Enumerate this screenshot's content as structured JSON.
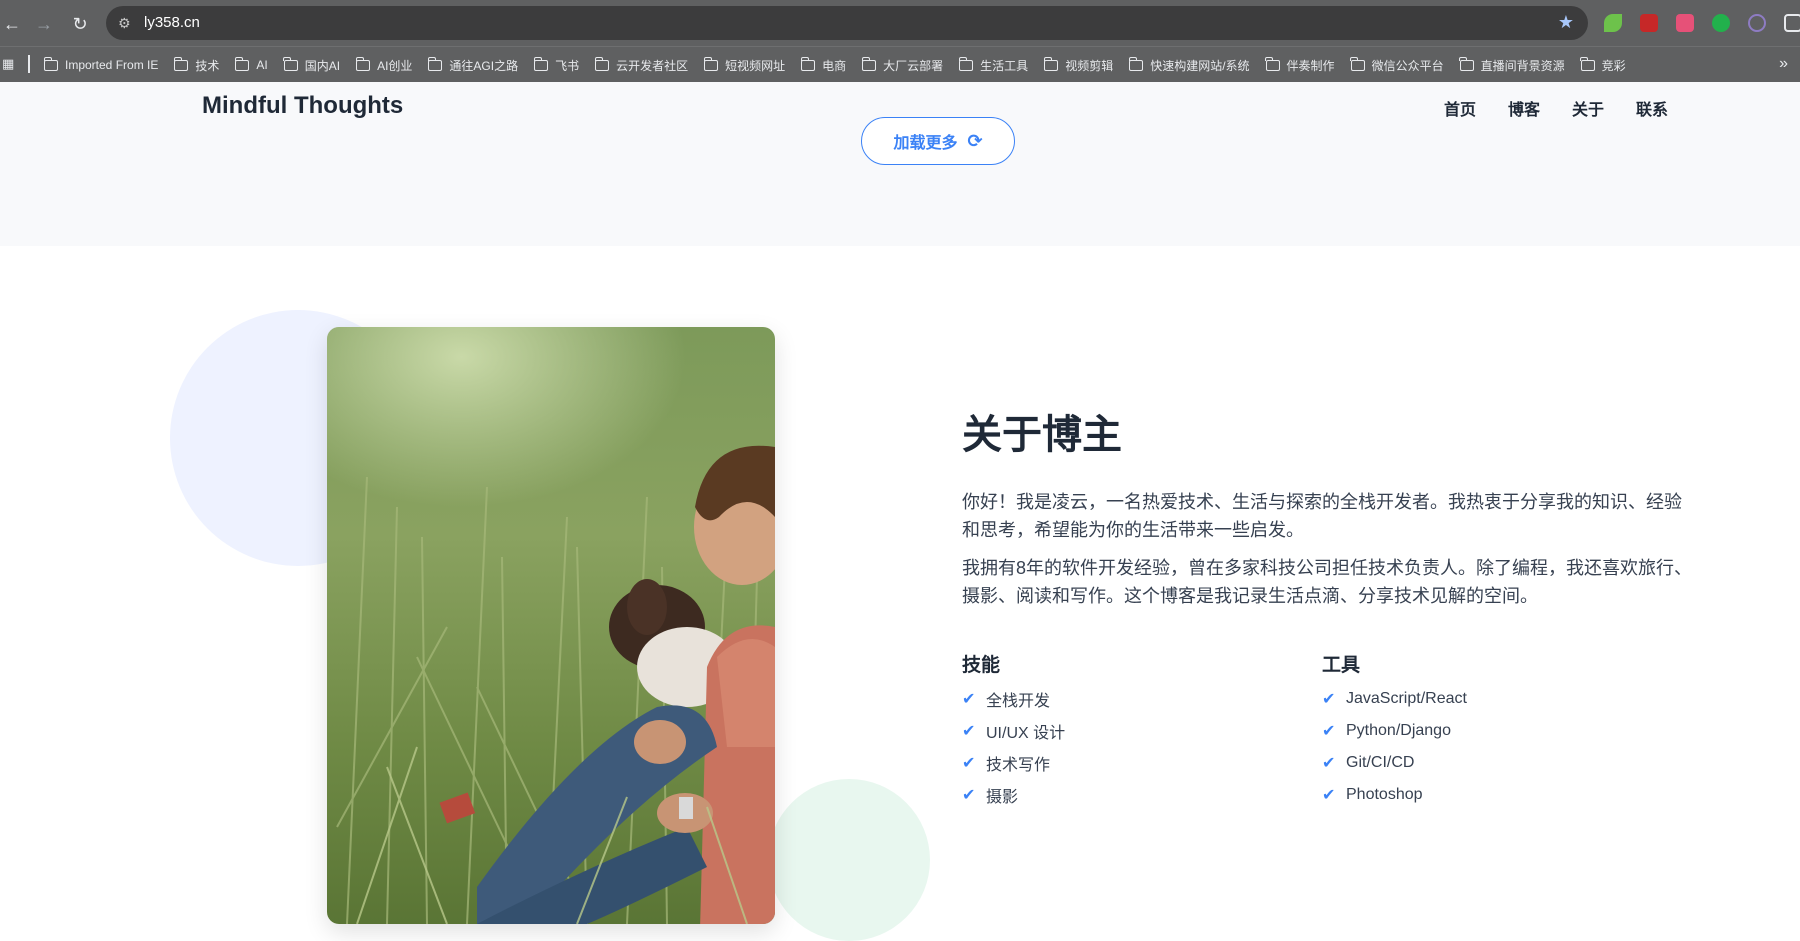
{
  "browser": {
    "url": "ly358.cn",
    "bookmarks": [
      "Imported From IE",
      "技术",
      "AI",
      "国内AI",
      "AI创业",
      "通往AGI之路",
      "飞书",
      "云开发者社区",
      "短视频网址",
      "电商",
      "大厂云部署",
      "生活工具",
      "视频剪辑",
      "快速构建网站/系统",
      "伴奏制作",
      "微信公众平台",
      "直播间背景资源",
      "竞彩"
    ]
  },
  "header": {
    "brand": "Mindful Thoughts",
    "nav": [
      "首页",
      "博客",
      "关于",
      "联系"
    ]
  },
  "load_more": {
    "label": "加载更多",
    "icon": "refresh-icon",
    "color": "#3b82f6"
  },
  "about": {
    "title": "关于博主",
    "paragraphs": [
      "你好！我是凌云，一名热爱技术、生活与探索的全栈开发者。我热衷于分享我的知识、经验和思考，希望能为你的生活带来一些启发。",
      "我拥有8年的软件开发经验，曾在多家科技公司担任技术负责人。除了编程，我还喜欢旅行、摄影、阅读和写作。这个博客是我记录生活点滴、分享技术见解的空间。"
    ],
    "skills": {
      "title": "技能",
      "items": [
        "全栈开发",
        "UI/UX 设计",
        "技术写作",
        "摄影"
      ]
    },
    "tools": {
      "title": "工具",
      "items": [
        "JavaScript/React",
        "Python/Django",
        "Git/CI/CD",
        "Photoshop"
      ]
    }
  },
  "colors": {
    "accent": "#3b82f6",
    "chrome": "#5f6061",
    "band": "#f8f9fb"
  }
}
